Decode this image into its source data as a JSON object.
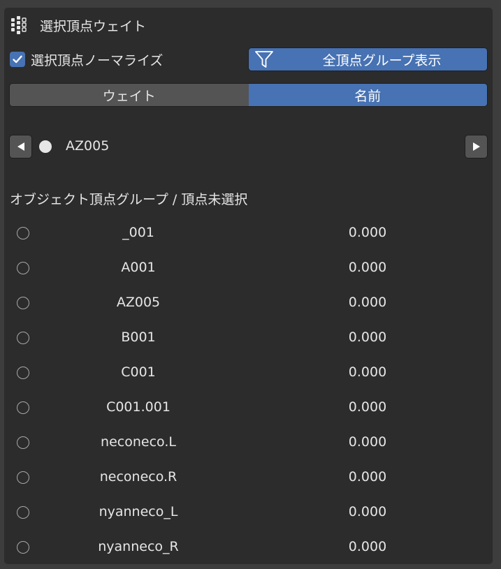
{
  "panel": {
    "title": "選択頂点ウェイト",
    "title_icon": "vertex-weights-icon"
  },
  "options": {
    "normalize_label": "選択頂点ノーマライズ",
    "normalize_checked": true,
    "show_all_label": "全頂点グループ表示",
    "filter_icon": "funnel-icon"
  },
  "sort_toggle": {
    "options": [
      {
        "label": "ウェイト",
        "selected": false
      },
      {
        "label": "名前",
        "selected": true
      }
    ]
  },
  "navigator": {
    "current_name": "AZ005",
    "prev_icon": "triangle-left-icon",
    "next_icon": "triangle-right-icon"
  },
  "vertex_groups": {
    "section_label": "オブジェクト頂点グループ / 頂点未選択",
    "items": [
      {
        "name": "_001",
        "weight": "0.000"
      },
      {
        "name": "A001",
        "weight": "0.000"
      },
      {
        "name": "AZ005",
        "weight": "0.000"
      },
      {
        "name": "B001",
        "weight": "0.000"
      },
      {
        "name": "C001",
        "weight": "0.000"
      },
      {
        "name": "C001.001",
        "weight": "0.000"
      },
      {
        "name": "neconeco.L",
        "weight": "0.000"
      },
      {
        "name": "neconeco.R",
        "weight": "0.000"
      },
      {
        "name": "nyanneco_L",
        "weight": "0.000"
      },
      {
        "name": "nyanneco_R",
        "weight": "0.000"
      }
    ]
  },
  "colors": {
    "accent": "#4772b3",
    "panel_bg": "#2c2c2c",
    "button_bg": "#545454"
  }
}
